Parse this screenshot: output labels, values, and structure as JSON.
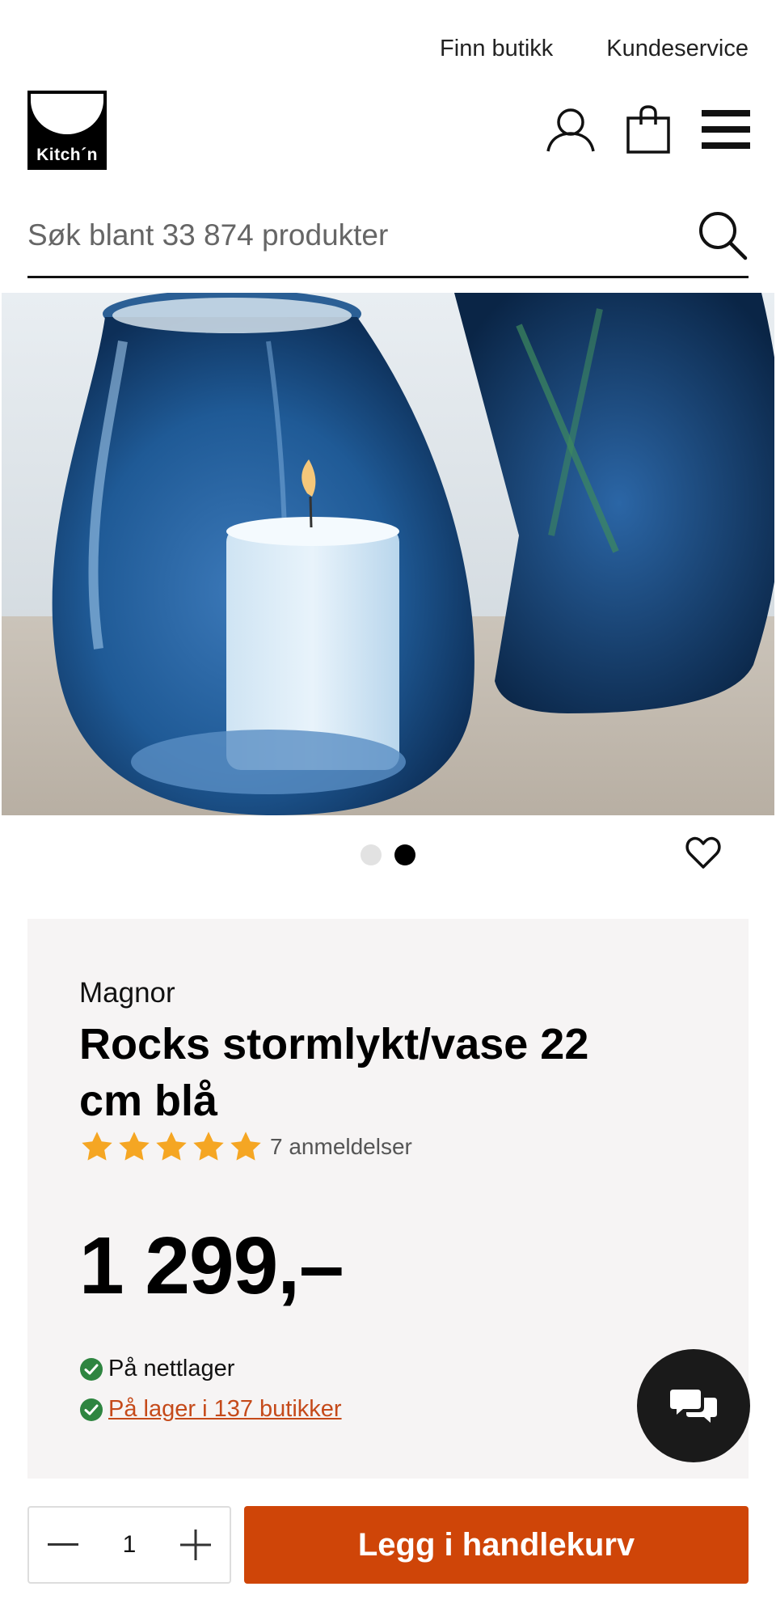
{
  "top_links": {
    "find_store": "Finn butikk",
    "customer_service": "Kundeservice"
  },
  "logo": {
    "text": "Kitch´n"
  },
  "header_icons": [
    "user-icon",
    "shopping-bag-icon",
    "menu-icon"
  ],
  "search": {
    "placeholder": "Søk blant 33 874 produkter"
  },
  "gallery": {
    "total_images": 2,
    "active_index": 1
  },
  "product": {
    "brand": "Magnor",
    "title": "Rocks stormlykt/vase 22 cm blå",
    "rating_stars": 5,
    "reviews": "7 anmeldelser",
    "price": "1 299,–",
    "stock_online": "På nettlager",
    "stock_stores": "På lager i 137 butikker"
  },
  "cart": {
    "quantity": "1",
    "add_label": "Legg i handlekurv"
  },
  "colors": {
    "accent": "#cf4508",
    "star": "#f5a623",
    "check": "#2e8540",
    "link": "#c54a1a",
    "card_bg": "#f6f4f4"
  }
}
